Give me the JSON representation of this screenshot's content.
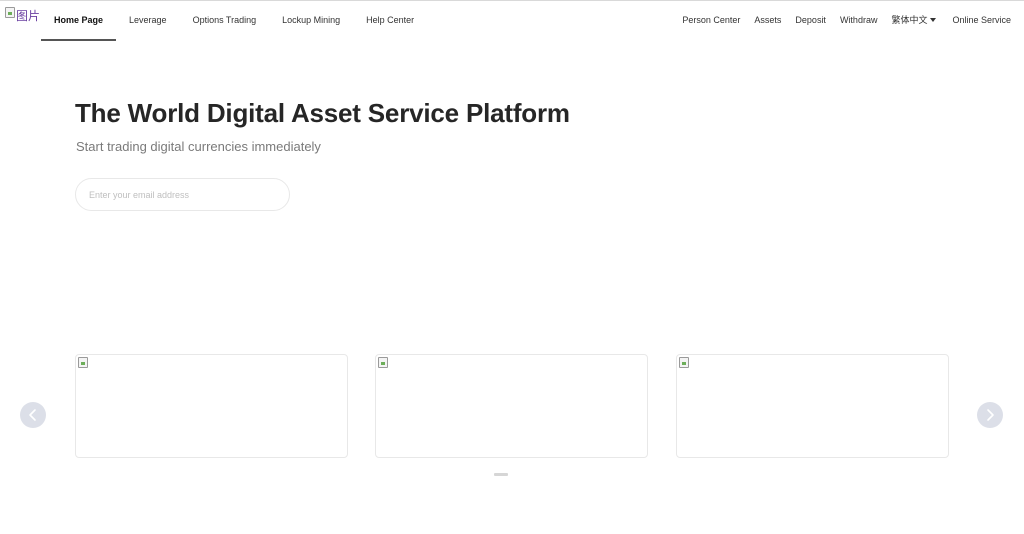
{
  "header": {
    "logo_alt": "图片",
    "nav_left": [
      {
        "label": "Home Page",
        "active": true
      },
      {
        "label": "Leverage"
      },
      {
        "label": "Options Trading"
      },
      {
        "label": "Lockup Mining"
      },
      {
        "label": "Help Center"
      }
    ],
    "nav_right": {
      "person_center": "Person Center",
      "assets": "Assets",
      "deposit": "Deposit",
      "withdraw": "Withdraw",
      "language": "繁体中文",
      "online_service": "Online Service"
    }
  },
  "hero": {
    "title": "The World Digital Asset Service Platform",
    "subtitle": "Start trading digital currencies immediately",
    "email_placeholder": "Enter your email address",
    "email_value": ""
  },
  "icons": {
    "logo": "broken-image-icon",
    "language_dropdown": "caret-down-icon",
    "carousel_prev": "chevron-left-icon",
    "carousel_next": "chevron-right-icon"
  },
  "colors": {
    "text_primary": "#262626",
    "text_secondary": "#7a7a7a",
    "arrow_bg": "#dcdfe8",
    "card_border": "#e8e8e8"
  }
}
